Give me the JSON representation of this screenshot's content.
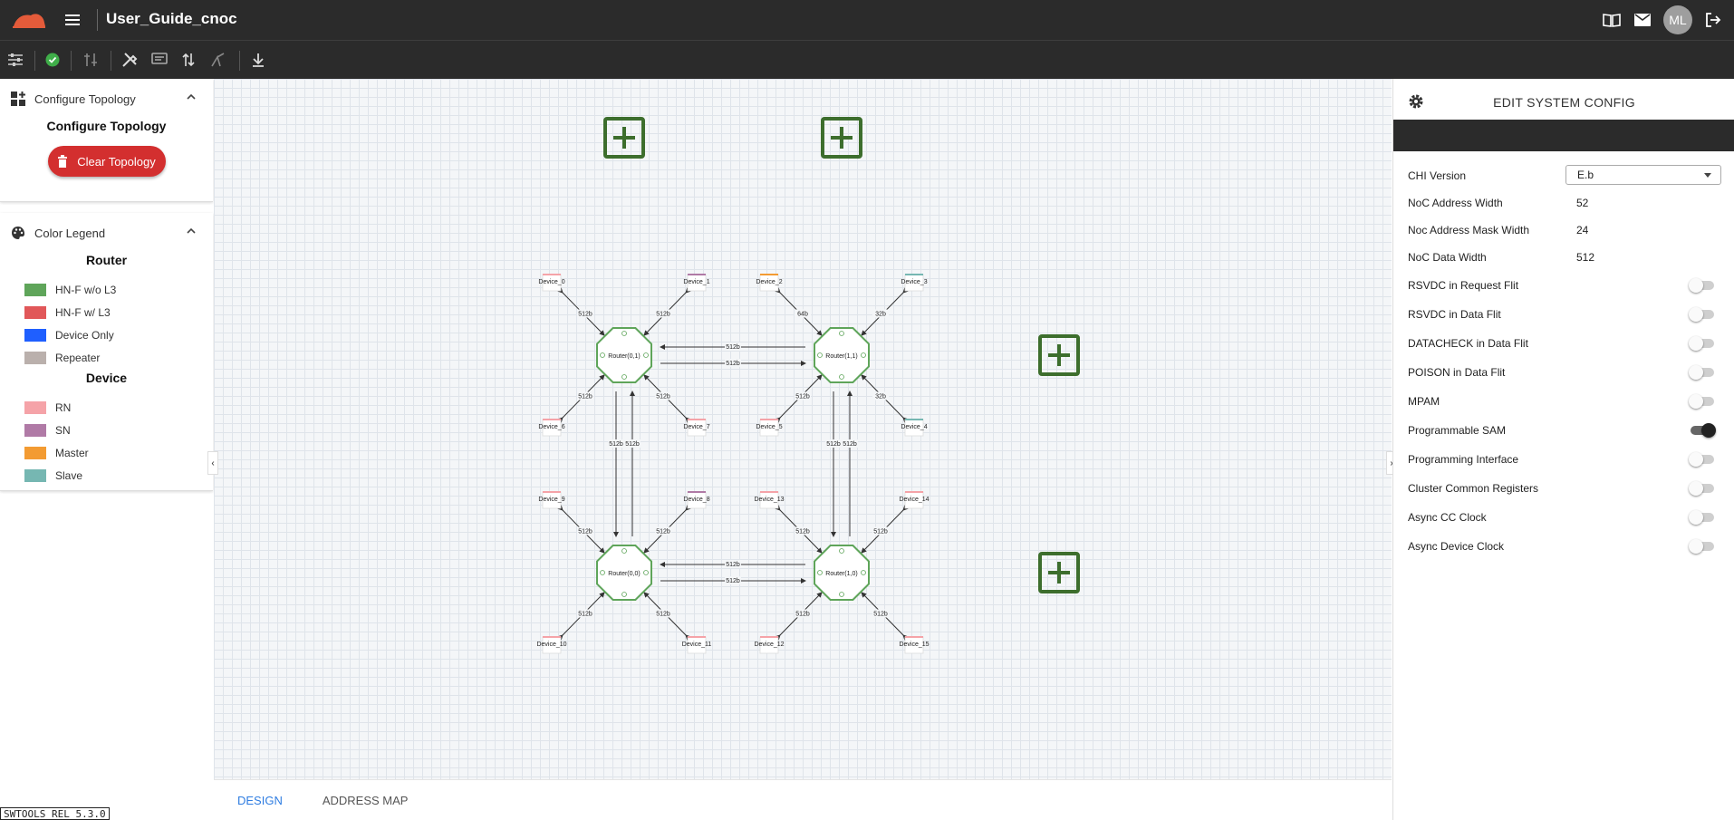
{
  "app": {
    "title": "User_Guide_cnoc",
    "avatar": "ML",
    "version": "SWTOOLS_REL_5.3.0"
  },
  "colors": {
    "router_green": "#5fa55a",
    "rn": "#f5a3a8",
    "sn": "#b07aa6",
    "master": "#f39b32",
    "slave": "#76b7b2",
    "danger": "#d32f2f",
    "accent": "#2f7de1"
  },
  "left": {
    "configure": {
      "header": "Configure Topology",
      "title": "Configure Topology",
      "clear_button": "Clear Topology"
    },
    "legend": {
      "header": "Color Legend",
      "router_title": "Router",
      "router_items": [
        {
          "label": "HN-F w/o L3",
          "color": "#5fa55a"
        },
        {
          "label": "HN-F w/ L3",
          "color": "#e15759"
        },
        {
          "label": "Device Only",
          "color": "#1f5fff"
        },
        {
          "label": "Repeater",
          "color": "#bab0ac"
        }
      ],
      "device_title": "Device",
      "device_items": [
        {
          "label": "RN",
          "color": "#f5a3a8"
        },
        {
          "label": "SN",
          "color": "#b07aa6"
        },
        {
          "label": "Master",
          "color": "#f39b32"
        },
        {
          "label": "Slave",
          "color": "#76b7b2"
        }
      ]
    }
  },
  "diagram": {
    "routers": [
      "Router(0,1)",
      "Router(1,1)",
      "Router(0,0)",
      "Router(1,0)"
    ],
    "devices": [
      "Device_0",
      "Device_1",
      "Device_2",
      "Device_3",
      "Device_4",
      "Device_5",
      "Device_6",
      "Device_7",
      "Device_8",
      "Device_9",
      "Device_10",
      "Device_11",
      "Device_12",
      "Device_13",
      "Device_14",
      "Device_15"
    ],
    "link_label": "512b",
    "link_label_64": "64b",
    "link_label_32": "32b"
  },
  "tabs": [
    {
      "label": "DESIGN"
    },
    {
      "label": "ADDRESS MAP"
    }
  ],
  "right": {
    "title": "EDIT SYSTEM CONFIG",
    "chi_version": {
      "label": "CHI Version",
      "value": "E.b"
    },
    "fields": [
      {
        "label": "NoC Address Width",
        "value": "52"
      },
      {
        "label": "Noc Address Mask Width",
        "value": "24"
      },
      {
        "label": "NoC Data Width",
        "value": "512"
      }
    ],
    "toggles": [
      {
        "label": "RSVDC in Request Flit",
        "on": false
      },
      {
        "label": "RSVDC in Data Flit",
        "on": false
      },
      {
        "label": "DATACHECK in Data Flit",
        "on": false
      },
      {
        "label": "POISON in Data Flit",
        "on": false
      },
      {
        "label": "MPAM",
        "on": false
      },
      {
        "label": "Programmable SAM",
        "on": true
      },
      {
        "label": "Programming Interface",
        "on": false
      },
      {
        "label": "Cluster Common Registers",
        "on": false
      },
      {
        "label": "Async CC Clock",
        "on": false
      },
      {
        "label": "Async Device Clock",
        "on": false
      }
    ]
  }
}
